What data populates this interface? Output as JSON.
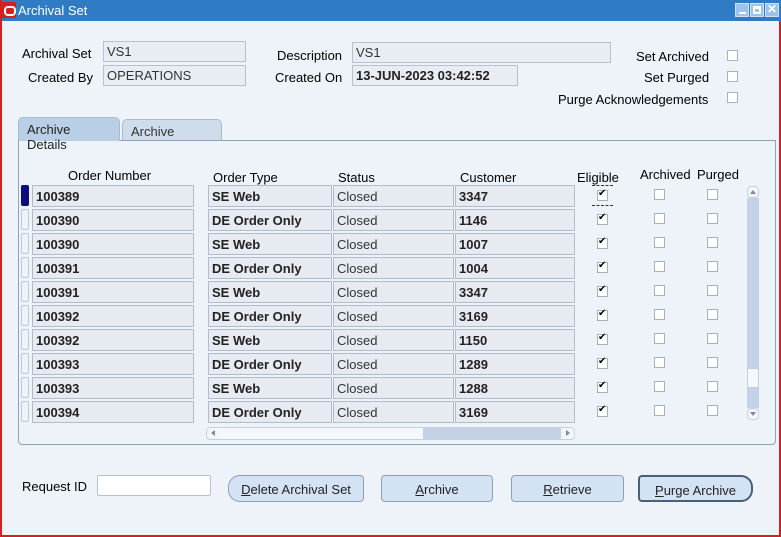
{
  "window": {
    "title": "Archival Set",
    "controls": {
      "minimize": "minimize-icon",
      "maximize": "maximize-icon",
      "close": "close-icon"
    }
  },
  "header": {
    "archival_set_label": "Archival Set",
    "archival_set_value": "VS1",
    "created_by_label": "Created By",
    "created_by_value": "OPERATIONS",
    "description_label": "Description",
    "description_value": "VS1",
    "created_on_label": "Created On",
    "created_on_value": "13-JUN-2023 03:42:52",
    "set_archived_label": "Set Archived",
    "set_archived_checked": false,
    "set_purged_label": "Set Purged",
    "set_purged_checked": false,
    "purge_ack_label": "Purge Acknowledgements",
    "purge_ack_checked": false
  },
  "tabs": [
    {
      "label": "Archive Details",
      "active": true
    },
    {
      "label": "Archive Criteria",
      "active": false
    }
  ],
  "table": {
    "columns": {
      "order_number": "Order Number",
      "order_type": "Order Type",
      "status": "Status",
      "customer": "Customer",
      "eligible": "Eligible",
      "archived": "Archived",
      "purged": "Purged"
    },
    "rows": [
      {
        "order_number": "100389",
        "order_type": "SE Web",
        "status": "Closed",
        "customer": "3347",
        "eligible": true,
        "archived": false,
        "purged": false,
        "current": true
      },
      {
        "order_number": "100390",
        "order_type": "DE Order Only",
        "status": "Closed",
        "customer": "1146",
        "eligible": true,
        "archived": false,
        "purged": false
      },
      {
        "order_number": "100390",
        "order_type": "SE Web",
        "status": "Closed",
        "customer": "1007",
        "eligible": true,
        "archived": false,
        "purged": false
      },
      {
        "order_number": "100391",
        "order_type": "DE Order Only",
        "status": "Closed",
        "customer": "1004",
        "eligible": true,
        "archived": false,
        "purged": false
      },
      {
        "order_number": "100391",
        "order_type": "SE Web",
        "status": "Closed",
        "customer": "3347",
        "eligible": true,
        "archived": false,
        "purged": false
      },
      {
        "order_number": "100392",
        "order_type": "DE Order Only",
        "status": "Closed",
        "customer": "3169",
        "eligible": true,
        "archived": false,
        "purged": false
      },
      {
        "order_number": "100392",
        "order_type": "SE Web",
        "status": "Closed",
        "customer": "1150",
        "eligible": true,
        "archived": false,
        "purged": false
      },
      {
        "order_number": "100393",
        "order_type": "DE Order Only",
        "status": "Closed",
        "customer": "1289",
        "eligible": true,
        "archived": false,
        "purged": false
      },
      {
        "order_number": "100393",
        "order_type": "SE Web",
        "status": "Closed",
        "customer": "1288",
        "eligible": true,
        "archived": false,
        "purged": false
      },
      {
        "order_number": "100394",
        "order_type": "DE Order Only",
        "status": "Closed",
        "customer": "3169",
        "eligible": true,
        "archived": false,
        "purged": false
      }
    ]
  },
  "footer": {
    "request_id_label": "Request ID",
    "request_id_value": "",
    "buttons": [
      {
        "label_mnemonic": "D",
        "label_rest": "elete Archival Set"
      },
      {
        "label_mnemonic": "A",
        "label_rest": "rchive"
      },
      {
        "label_mnemonic": "R",
        "label_rest": "etrieve"
      },
      {
        "label_mnemonic": "P",
        "label_rest": "urge Archive"
      }
    ]
  },
  "colors": {
    "titlebar": "#2f7bc4",
    "window_border": "#d61f1f",
    "current_row_indicator": "#0b0e7a",
    "background": "#eef2f9"
  }
}
